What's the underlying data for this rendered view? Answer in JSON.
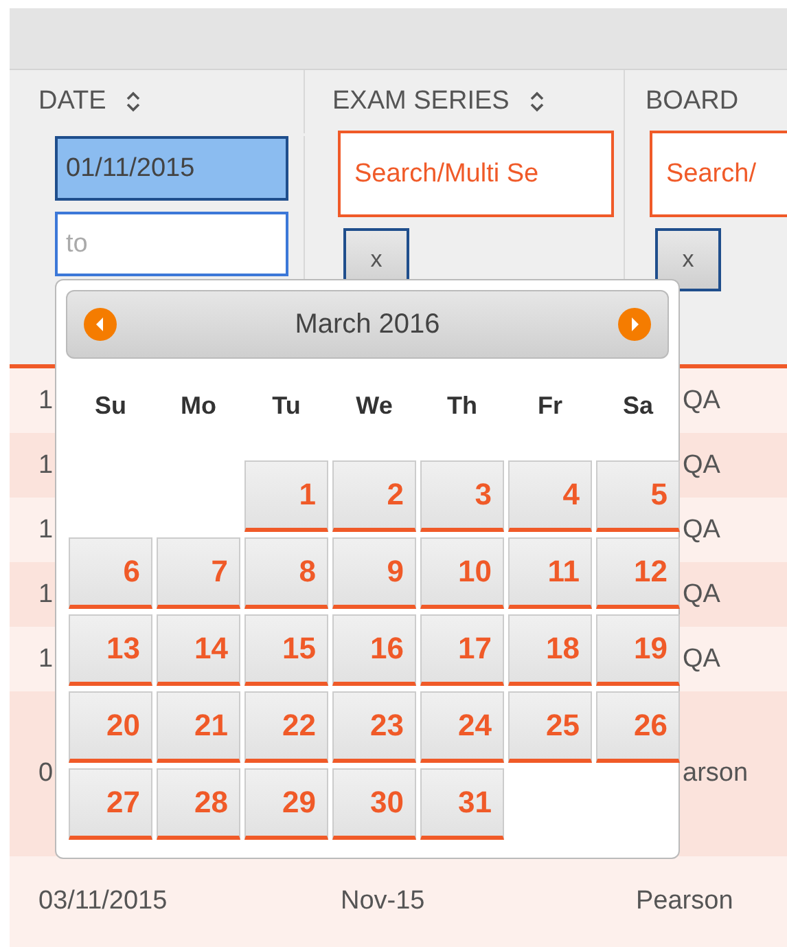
{
  "columns": [
    {
      "label": "DATE",
      "sortable": true
    },
    {
      "label": "EXAM SERIES",
      "sortable": true
    },
    {
      "label": "BOARD",
      "sortable": false
    }
  ],
  "filters": {
    "date_from": {
      "value": "01/11/2015",
      "selected": true
    },
    "date_to": {
      "placeholder": "to",
      "focused": true
    },
    "searches": [
      {
        "placeholder": "Search/Multi Se",
        "clear": "x"
      },
      {
        "placeholder": "Search/",
        "clear": "x"
      }
    ]
  },
  "rows": [
    {
      "kind": "partial",
      "date": "1",
      "series": "",
      "board": "QA"
    },
    {
      "kind": "partial",
      "date": "1",
      "series": "",
      "board": "QA"
    },
    {
      "kind": "partial",
      "date": "1",
      "series": "",
      "board": "QA"
    },
    {
      "kind": "partial",
      "date": "1",
      "series": "",
      "board": "QA"
    },
    {
      "kind": "partial",
      "date": "1",
      "series": "",
      "board": "QA"
    },
    {
      "kind": "partial_tall",
      "date": "0",
      "series": "",
      "board": "arson"
    },
    {
      "kind": "full",
      "date": "03/11/2015",
      "series": "Nov-15",
      "board": "Pearson"
    }
  ],
  "datepicker": {
    "title": "March 2016",
    "weekdays": [
      "Su",
      "Mo",
      "Tu",
      "We",
      "Th",
      "Fr",
      "Sa"
    ],
    "weeks": [
      [
        {
          "kind": "blank"
        },
        {
          "kind": "blank"
        },
        {
          "kind": "day",
          "day": "1"
        },
        {
          "kind": "day",
          "day": "2"
        },
        {
          "kind": "day",
          "day": "3"
        },
        {
          "kind": "day",
          "day": "4"
        },
        {
          "kind": "day",
          "day": "5"
        }
      ],
      [
        {
          "kind": "day",
          "day": "6"
        },
        {
          "kind": "day",
          "day": "7"
        },
        {
          "kind": "day",
          "day": "8"
        },
        {
          "kind": "day",
          "day": "9"
        },
        {
          "kind": "day",
          "day": "10"
        },
        {
          "kind": "day",
          "day": "11"
        },
        {
          "kind": "day",
          "day": "12"
        }
      ],
      [
        {
          "kind": "day",
          "day": "13"
        },
        {
          "kind": "day",
          "day": "14"
        },
        {
          "kind": "day",
          "day": "15"
        },
        {
          "kind": "day",
          "day": "16"
        },
        {
          "kind": "day",
          "day": "17"
        },
        {
          "kind": "day",
          "day": "18"
        },
        {
          "kind": "day",
          "day": "19"
        }
      ],
      [
        {
          "kind": "day",
          "day": "20"
        },
        {
          "kind": "day",
          "day": "21"
        },
        {
          "kind": "day",
          "day": "22"
        },
        {
          "kind": "day",
          "day": "23"
        },
        {
          "kind": "day",
          "day": "24"
        },
        {
          "kind": "day",
          "day": "25"
        },
        {
          "kind": "day",
          "day": "26"
        }
      ],
      [
        {
          "kind": "day",
          "day": "27"
        },
        {
          "kind": "day",
          "day": "28"
        },
        {
          "kind": "day",
          "day": "29"
        },
        {
          "kind": "day",
          "day": "30"
        },
        {
          "kind": "day",
          "day": "31"
        },
        {
          "kind": "blank"
        },
        {
          "kind": "blank"
        }
      ]
    ]
  }
}
